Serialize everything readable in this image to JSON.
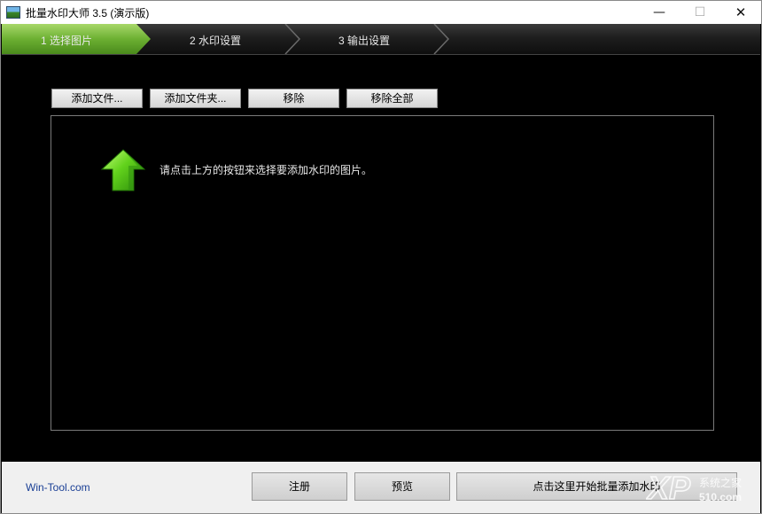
{
  "window": {
    "title": "批量水印大师 3.5 (演示版)"
  },
  "controls": {
    "minimize": "—",
    "maximize": "☐",
    "close": "✕"
  },
  "steps": [
    {
      "label": "1 选择图片",
      "active": true
    },
    {
      "label": "2 水印设置",
      "active": false
    },
    {
      "label": "3 输出设置",
      "active": false
    }
  ],
  "toolbar": {
    "add_file": "添加文件...",
    "add_folder": "添加文件夹...",
    "remove": "移除",
    "remove_all": "移除全部"
  },
  "list": {
    "hint": "请点击上方的按钮来选择要添加水印的图片。"
  },
  "footer": {
    "link": "Win-Tool.com",
    "register": "注册",
    "preview": "预览",
    "start": "点击这里开始批量添加水印"
  },
  "watermark_logo": {
    "main": "XP",
    "sub": "系统之家",
    "num": "510.com"
  },
  "colors": {
    "accent_green": "#5fa82a",
    "link_blue": "#1a3f95"
  }
}
